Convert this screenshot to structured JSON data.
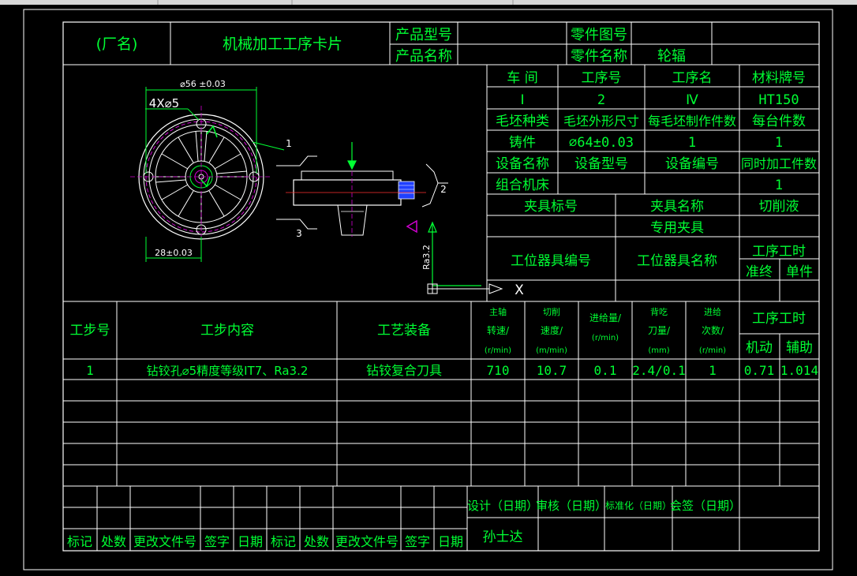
{
  "title": {
    "factory": "(厂名)",
    "card_name": "机械加工工序卡片",
    "product_model_label": "产品型号",
    "product_name_label": "产品名称",
    "part_drawing_no_label": "零件图号",
    "part_name_label": "零件名称",
    "part_name_value": "轮辐"
  },
  "info": {
    "workshop_label": "车 间",
    "process_no_label": "工序号",
    "process_name_label": "工序名",
    "material_label": "材料牌号",
    "workshop_value": "Ⅰ",
    "process_no_value": "2",
    "process_name_value": "Ⅳ",
    "material_value": "HT150",
    "blank_type_label": "毛坯种类",
    "blank_size_label": "毛坯外形尺寸",
    "pieces_per_blank_label": "每毛坯制作件数",
    "pieces_per_machine_label": "每台件数",
    "blank_type_value": "铸件",
    "blank_size_value": "⌀64±0.03",
    "pieces_per_blank_value": "1",
    "pieces_per_machine_value": "1",
    "equip_name_label": "设备名称",
    "equip_model_label": "设备型号",
    "equip_no_label": "设备编号",
    "simultaneous_label": "同时加工件数",
    "equip_name_value": "组合机床",
    "simultaneous_value": "1",
    "fixture_no_label": "夹具标号",
    "fixture_name_label": "夹具名称",
    "coolant_label": "切削液",
    "fixture_name_value": "专用夹具",
    "station_tool_no_label": "工位器具编号",
    "station_tool_name_label": "工位器具名称",
    "process_time_label": "工序工时",
    "prep_end_label": "准终",
    "unit_label": "单件"
  },
  "drawing": {
    "dim_outer": "⌀56 ±0.03",
    "dim_holes": "4X⌀5",
    "dim_inner": "28±0.03",
    "callout_1": "1",
    "callout_2": "2",
    "callout_3": "3",
    "roughness": "Ra3.2",
    "axis_x": "X"
  },
  "steps": {
    "headers": {
      "step_no": "工步号",
      "content": "工步内容",
      "equipment": "工艺装备",
      "spindle": [
        "主轴",
        "转速/",
        "(r/min)"
      ],
      "cutting": [
        "切削",
        "速度/",
        "(m/min)"
      ],
      "feed": [
        "进给量/",
        "(r/min)"
      ],
      "depth": [
        "背吃",
        "刀量/",
        "(mm)"
      ],
      "passes": [
        "进给",
        "次数/",
        "(r/min)"
      ],
      "time": "工序工时",
      "machine": "机动",
      "aux": "辅助"
    },
    "rows": [
      {
        "no": "1",
        "content": "钻铰孔⌀5精度等级IT7、Ra3.2",
        "equipment": "钻铰复合刀具",
        "spindle": "710",
        "cutting": "10.7",
        "feed": "0.1",
        "depth": "2.4/0.1",
        "passes": "1",
        "machine": "0.71",
        "aux": "1.014"
      }
    ]
  },
  "signoff": {
    "design": "设计（日期）",
    "review": "审核（日期）",
    "standard": "标准化（日期）",
    "countersign": "会签（日期）",
    "designer": "孙士达",
    "left_labels": [
      "标记",
      "处数",
      "更改文件号",
      "签字",
      "日期",
      "标记",
      "处数",
      "更改文件号",
      "签字",
      "日期"
    ]
  }
}
